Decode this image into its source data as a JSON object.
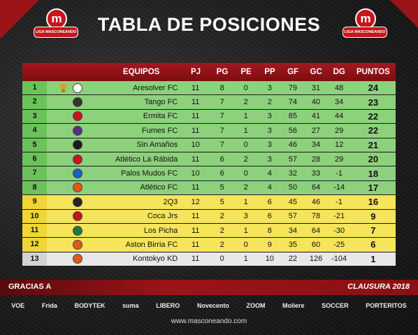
{
  "header": {
    "title": "TABLA DE POSICIONES",
    "logo_letter": "m",
    "logo_text": "LIGA MASCONEANDO"
  },
  "columns": [
    "EQUIPOS",
    "PJ",
    "PG",
    "PE",
    "PP",
    "GF",
    "GC",
    "DG",
    "PUNTOS"
  ],
  "rows": [
    {
      "pos": "1",
      "team": "Aresolver FC",
      "pj": "11",
      "pg": "8",
      "pe": "0",
      "pp": "3",
      "gf": "79",
      "gc": "31",
      "dg": "48",
      "pts": "24",
      "zone": "green",
      "crest": "#ffffff",
      "trophy": true
    },
    {
      "pos": "2",
      "team": "Tango FC",
      "pj": "11",
      "pg": "7",
      "pe": "2",
      "pp": "2",
      "gf": "74",
      "gc": "40",
      "dg": "34",
      "pts": "23",
      "zone": "green",
      "crest": "#333333"
    },
    {
      "pos": "3",
      "team": "Ermita FC",
      "pj": "11",
      "pg": "7",
      "pe": "1",
      "pp": "3",
      "gf": "85",
      "gc": "41",
      "dg": "44",
      "pts": "22",
      "zone": "green",
      "crest": "#c8141b"
    },
    {
      "pos": "4",
      "team": "Fumes FC",
      "pj": "11",
      "pg": "7",
      "pe": "1",
      "pp": "3",
      "gf": "56",
      "gc": "27",
      "dg": "29",
      "pts": "22",
      "zone": "green",
      "crest": "#5a2d82"
    },
    {
      "pos": "5",
      "team": "Sin Amaños",
      "pj": "10",
      "pg": "7",
      "pe": "0",
      "pp": "3",
      "gf": "46",
      "gc": "34",
      "dg": "12",
      "pts": "21",
      "zone": "green",
      "crest": "#1b1b1b"
    },
    {
      "pos": "6",
      "team": "Atlético La Rábida",
      "pj": "11",
      "pg": "6",
      "pe": "2",
      "pp": "3",
      "gf": "57",
      "gc": "28",
      "dg": "29",
      "pts": "20",
      "zone": "green",
      "crest": "#c8141b"
    },
    {
      "pos": "7",
      "team": "Palos Mudos FC",
      "pj": "10",
      "pg": "6",
      "pe": "0",
      "pp": "4",
      "gf": "32",
      "gc": "33",
      "dg": "-1",
      "pts": "18",
      "zone": "green",
      "crest": "#1d5fbf"
    },
    {
      "pos": "8",
      "team": "Atlético FC",
      "pj": "11",
      "pg": "5",
      "pe": "2",
      "pp": "4",
      "gf": "50",
      "gc": "64",
      "dg": "-14",
      "pts": "17",
      "zone": "green",
      "crest": "#e0591a"
    },
    {
      "pos": "9",
      "team": "2Q3",
      "pj": "12",
      "pg": "5",
      "pe": "1",
      "pp": "6",
      "gf": "45",
      "gc": "46",
      "dg": "-1",
      "pts": "16",
      "zone": "yellow",
      "crest": "#222222"
    },
    {
      "pos": "10",
      "team": "Coca Jrs",
      "pj": "11",
      "pg": "2",
      "pe": "3",
      "pp": "6",
      "gf": "57",
      "gc": "78",
      "dg": "-21",
      "pts": "9",
      "zone": "yellow",
      "crest": "#c8141b"
    },
    {
      "pos": "11",
      "team": "Los Picha",
      "pj": "11",
      "pg": "2",
      "pe": "1",
      "pp": "8",
      "gf": "34",
      "gc": "64",
      "dg": "-30",
      "pts": "7",
      "zone": "yellow",
      "crest": "#1d7a3a"
    },
    {
      "pos": "12",
      "team": "Aston Birria FC",
      "pj": "11",
      "pg": "2",
      "pe": "0",
      "pp": "9",
      "gf": "35",
      "gc": "60",
      "dg": "-25",
      "pts": "6",
      "zone": "yellow",
      "crest": "#e0591a"
    },
    {
      "pos": "13",
      "team": "Kontokyo KD",
      "pj": "11",
      "pg": "0",
      "pe": "1",
      "pp": "10",
      "gf": "22",
      "gc": "126",
      "dg": "-104",
      "pts": "1",
      "zone": "gray",
      "crest": "#e0591a"
    }
  ],
  "colors": {
    "green": "#8ed17d",
    "yellow": "#f6e45a",
    "gray": "#e8e8e8",
    "pos_green": "#6cc25a",
    "pos_yellow": "#efd535",
    "pos_gray": "#d3d3d3"
  },
  "band": {
    "thanks": "GRACIAS A",
    "season": "CLAUSURA 2018"
  },
  "sponsors": [
    "VOE",
    "Frida",
    "BODYTEK",
    "suma",
    "LIBERO",
    "Novecento",
    "ZOOM",
    "Moliere",
    "SOCCER",
    "PORTERITOS"
  ],
  "footer": "www.masconeando.com"
}
